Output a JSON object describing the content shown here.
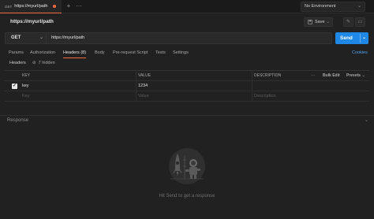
{
  "tabbar": {
    "tab": {
      "method": "GET",
      "name": "https://myurl/path"
    },
    "add_icon": "+",
    "more_icon": "···",
    "environment": "No Environment"
  },
  "request": {
    "title": "https://myurl/path",
    "save_label": "Save",
    "method": "GET",
    "url": "https://myurl/path",
    "send_label": "Send"
  },
  "tabs": [
    {
      "label": "Params"
    },
    {
      "label": "Authorization"
    },
    {
      "label": "Headers (8)"
    },
    {
      "label": "Body"
    },
    {
      "label": "Pre-request Script"
    },
    {
      "label": "Tests"
    },
    {
      "label": "Settings"
    }
  ],
  "active_tab": "Headers (8)",
  "cookies_label": "Cookies",
  "headers_section": {
    "label": "Headers",
    "hidden_toggle": "7 hidden"
  },
  "table": {
    "columns": {
      "key": "KEY",
      "value": "VALUE",
      "description": "DESCRIPTION"
    },
    "more_icon": "···",
    "bulk_edit": "Bulk Edit",
    "presets": "Presets",
    "rows": [
      {
        "key": "key",
        "value": "1234",
        "description": ""
      }
    ],
    "placeholder": {
      "key": "Key",
      "value": "Value",
      "description": "Description"
    }
  },
  "response": {
    "label": "Response",
    "empty_message": "Hit Send to get a response"
  },
  "colors": {
    "accent": "#f26b3a",
    "primary": "#1f87e5",
    "background": "#212121"
  }
}
